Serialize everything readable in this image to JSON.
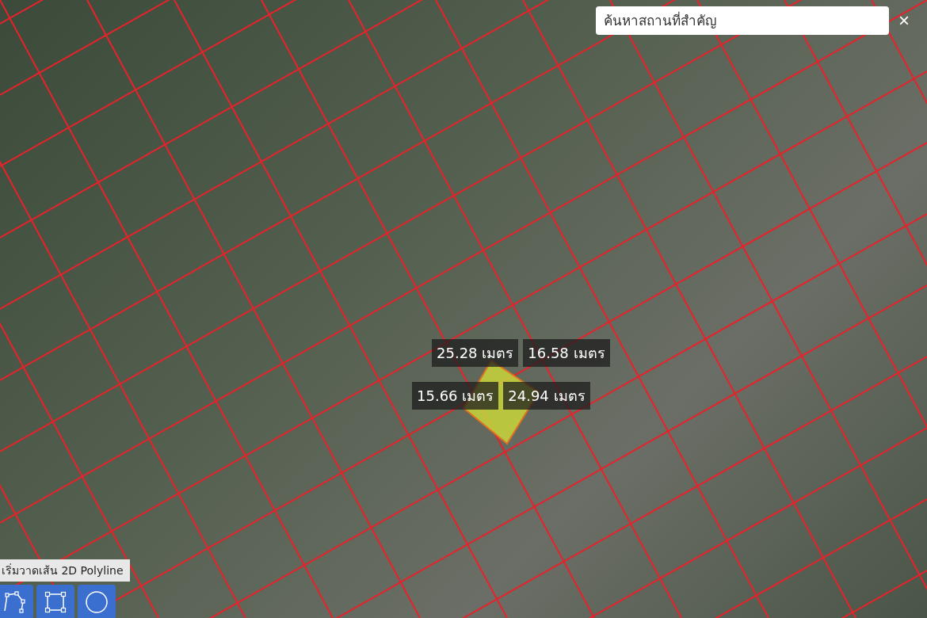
{
  "search": {
    "placeholder": "ค้นหาสถานที่สำคัญ",
    "close": "×"
  },
  "measurement_rows": [
    [
      "25.28 เมตร",
      "16.58 เมตร"
    ],
    [
      "15.66 เมตร",
      "24.94 เมตร"
    ]
  ],
  "draw_tools": {
    "tooltip": "เริ่มวาดเส้น 2D Polyline",
    "tools": [
      {
        "kind": "polyline"
      },
      {
        "kind": "rectangle"
      },
      {
        "kind": "circle"
      }
    ]
  }
}
